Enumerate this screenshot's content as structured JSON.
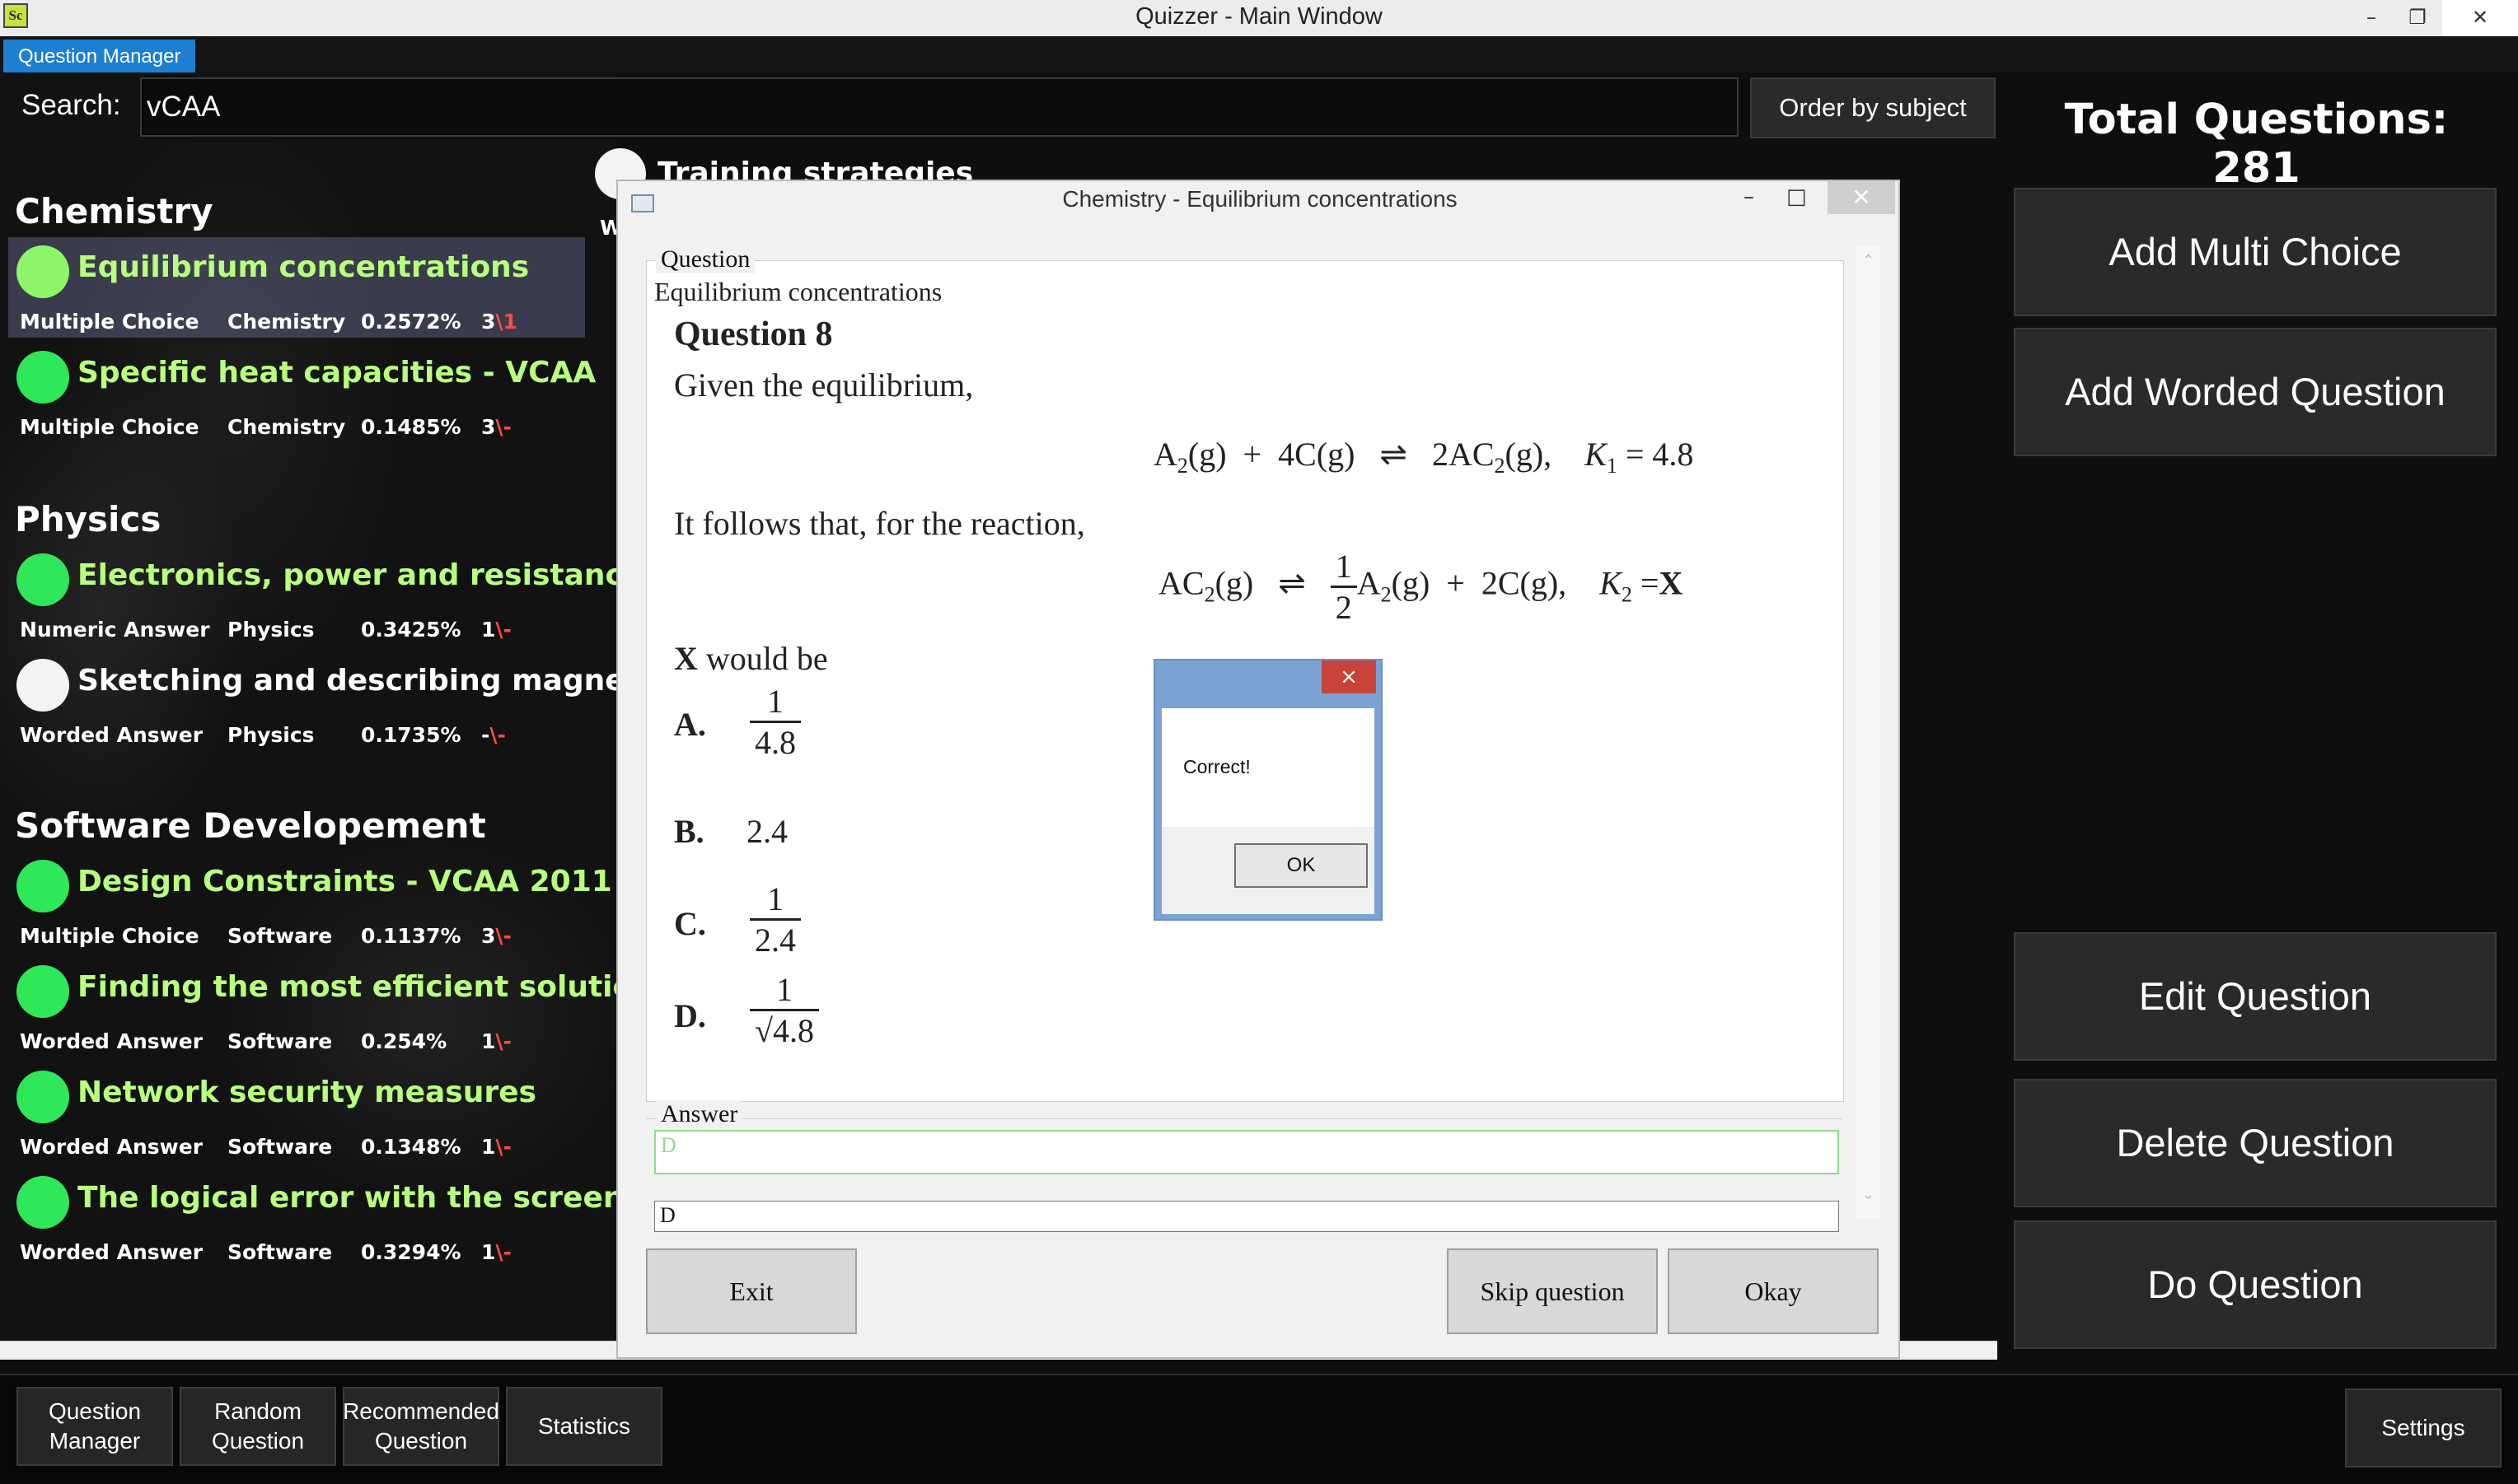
{
  "window": {
    "title": "Quizzer - Main Window",
    "icon_text": "Sc"
  },
  "tabs": {
    "active": "Question Manager"
  },
  "search": {
    "label": "Search:",
    "value": "vCAA"
  },
  "order_button": "Order by subject",
  "total_questions": "Total Questions: 281",
  "behind_item": {
    "title": "Training strategies",
    "meta_fragment": "W"
  },
  "sections": [
    {
      "name": "Chemistry",
      "items": [
        {
          "title": "Equilibrium concentrations",
          "type": "Multiple Choice",
          "subject": "Chemistry",
          "percent": "0.2572%",
          "score": "3",
          "sep": "\\",
          "tail": "1",
          "circle": "#8ef56a",
          "selected": true
        },
        {
          "title": "Specific heat capacities - VCAA",
          "type": "Multiple Choice",
          "subject": "Chemistry",
          "percent": "0.1485%",
          "score": "3",
          "sep": "\\",
          "tail": "-",
          "circle": "#2ee85a",
          "selected": false
        }
      ]
    },
    {
      "name": "Physics",
      "items": [
        {
          "title": "Electronics, power and resistance -",
          "type": "Numeric Answer",
          "subject": "Physics",
          "percent": "0.3425%",
          "score": "1",
          "sep": "\\",
          "tail": "-",
          "circle": "#2ee85a",
          "selected": false
        },
        {
          "title": "Sketching and describing magnetic",
          "type": "Worded Answer",
          "subject": "Physics",
          "percent": "0.1735%",
          "score": "-",
          "sep": "\\",
          "tail": "-",
          "circle": "#f3f3f3",
          "selected": false
        }
      ]
    },
    {
      "name": "Software Developement",
      "items": [
        {
          "title": "Design Constraints - VCAA 2011",
          "type": "Multiple Choice",
          "subject": "Software",
          "percent": "0.1137%",
          "score": "3",
          "sep": "\\",
          "tail": "-",
          "circle": "#2ee85a",
          "selected": false
        },
        {
          "title": "Finding the most efficient solution",
          "type": "Worded Answer",
          "subject": "Software",
          "percent": "0.254%",
          "score": "1",
          "sep": "\\",
          "tail": "-",
          "circle": "#2ee85a",
          "selected": false
        },
        {
          "title": "Network security measures",
          "type": "Worded Answer",
          "subject": "Software",
          "percent": "0.1348%",
          "score": "1",
          "sep": "\\",
          "tail": "-",
          "circle": "#2ee85a",
          "selected": false
        },
        {
          "title": "The logical error with the screen is",
          "type": "Worded Answer",
          "subject": "Software",
          "percent": "0.3294%",
          "score": "1",
          "sep": "\\",
          "tail": "-",
          "circle": "#2ee85a",
          "selected": false
        }
      ]
    }
  ],
  "right_buttons": {
    "add_multi": "Add Multi Choice",
    "add_worded": "Add Worded Question",
    "edit": "Edit Question",
    "delete": "Delete Question",
    "do": "Do Question"
  },
  "bottom_nav": {
    "question_manager": [
      "Question",
      "Manager"
    ],
    "random_question": [
      "Random",
      "Question"
    ],
    "recommended_question": [
      "Recommended",
      "Question"
    ],
    "statistics": "Statistics",
    "settings": "Settings"
  },
  "quiz": {
    "title": "Chemistry - Equilibrium concentrations",
    "question_group_label": "Question",
    "question_name": "Equilibrium concentrations",
    "question_number": "Question 8",
    "intro": "Given the equilibrium,",
    "eq1": {
      "lhs_a": "A",
      "lhs_a_sub": "2",
      "lhs_a_state": "(g)",
      "plus": "+",
      "lhs_b": "4C(g)",
      "arrow": "⇌",
      "rhs": "2AC",
      "rhs_sub": "2",
      "rhs_state": "(g),",
      "k": "K",
      "k_sub": "1",
      "k_val": "= 4.8"
    },
    "follows": "It follows that, for the reaction,",
    "eq2": {
      "lhs": "AC",
      "lhs_sub": "2",
      "lhs_state": "(g)",
      "arrow": "⇌",
      "frac_num": "1",
      "frac_den": "2",
      "rhs_a": "A",
      "rhs_a_sub": "2",
      "rhs_a_state": "(g)",
      "plus": "+",
      "rhs_b": "2C(g),",
      "k": "K",
      "k_sub": "2",
      "k_eq": "=",
      "k_val": "X"
    },
    "would_be_x": "X",
    "would_be": "would be",
    "options": [
      {
        "letter": "A.",
        "num": "1",
        "den": "4.8"
      },
      {
        "letter": "B.",
        "value": "2.4"
      },
      {
        "letter": "C.",
        "num": "1",
        "den": "2.4"
      },
      {
        "letter": "D.",
        "num": "1",
        "den": "√4.8"
      }
    ],
    "answer_group_label": "Answer",
    "answer_placeholder": "D",
    "answer_value": "D",
    "buttons": {
      "exit": "Exit",
      "skip": "Skip question",
      "okay": "Okay"
    }
  },
  "message_box": {
    "text": "Correct!",
    "ok": "OK",
    "close": "×"
  }
}
